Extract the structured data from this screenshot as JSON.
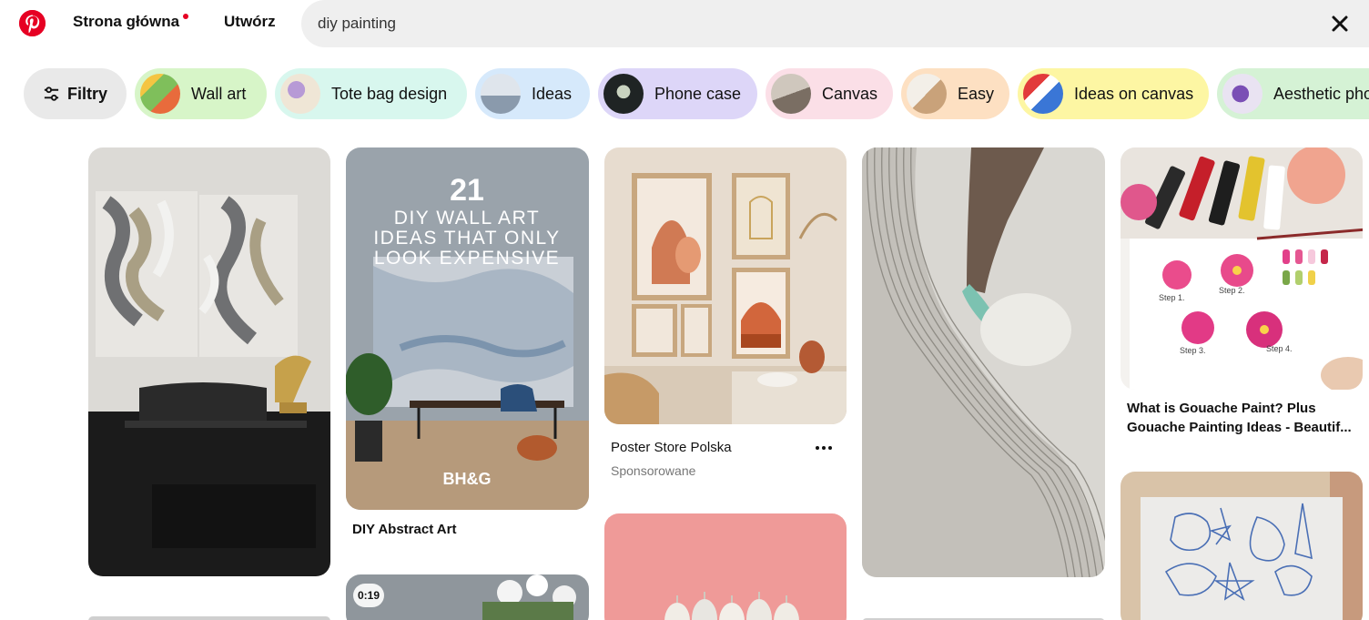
{
  "header": {
    "logo_icon": "pinterest-logo-icon",
    "nav_home": "Strona główna",
    "nav_create": "Utwórz",
    "search_value": "diy painting",
    "clear_icon": "close-icon"
  },
  "chips": {
    "filter_label": "Filtry",
    "filter_icon": "sliders-icon",
    "items": [
      {
        "label": "Wall art",
        "bg": "#d7f5c8"
      },
      {
        "label": "Tote bag design",
        "bg": "#d8f7ee"
      },
      {
        "label": "Ideas",
        "bg": "#d6e9fb"
      },
      {
        "label": "Phone case",
        "bg": "#ddd6f8"
      },
      {
        "label": "Canvas",
        "bg": "#fbdfe7"
      },
      {
        "label": "Easy",
        "bg": "#fde0c2"
      },
      {
        "label": "Ideas on canvas",
        "bg": "#fdf6a3"
      },
      {
        "label": "Aesthetic pho",
        "bg": "#d5f2d5"
      }
    ]
  },
  "pins": {
    "pin2_overlay": {
      "number": "21",
      "line1": "DIY WALL ART",
      "line2": "IDEAS THAT ONLY",
      "line3": "LOOK EXPENSIVE",
      "brand": "BH&G"
    },
    "pin2_title": "DIY Abstract Art",
    "pin3_source": "Poster Store Polska",
    "pin3_sponsored": "Sponsorowane",
    "pin5_title_line1": "What is Gouache Paint? Plus",
    "pin5_title_line2": "Gouache Painting Ideas - Beautif...",
    "pin5_steps": [
      "Step 1.",
      "Step 2.",
      "Step 3.",
      "Step 4."
    ],
    "video_duration": "0:19"
  }
}
